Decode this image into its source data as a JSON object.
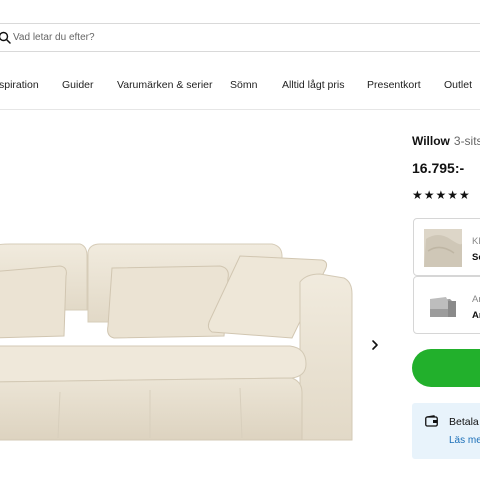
{
  "search": {
    "placeholder": "Vad letar du efter?"
  },
  "nav": {
    "items": [
      {
        "label": "spiration"
      },
      {
        "label": "Guider"
      },
      {
        "label": "Varumärken & serier"
      },
      {
        "label": "Sömn"
      },
      {
        "label": "Alltid lågt pris"
      },
      {
        "label": "Presentkort"
      },
      {
        "label": "Outlet"
      }
    ]
  },
  "product": {
    "name": "Willow",
    "subtitle": "3-sits",
    "price": "16.795:-",
    "rating": {
      "value": 4.5,
      "max": 5,
      "stars": "★★★★★"
    }
  },
  "options": [
    {
      "label": "Kl",
      "value": "Sc"
    },
    {
      "label": "Ar",
      "value": "Ar"
    }
  ],
  "payment": {
    "title": "Betala",
    "link": "Läs me"
  },
  "colors": {
    "buy_button": "#22b02c",
    "pay_box_bg": "#e8f3fb",
    "link": "#1b6fb8",
    "sofa_fabric": "#ede6d8"
  },
  "icons": {
    "search": "search-icon",
    "chevron": "chevron-right-icon",
    "payment": "wallet-icon"
  }
}
